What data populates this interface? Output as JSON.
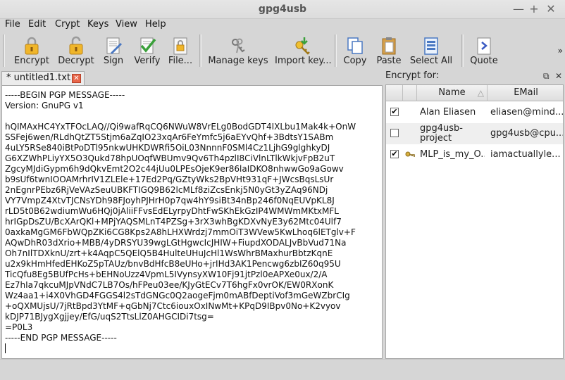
{
  "window": {
    "title": "gpg4usb"
  },
  "menu": [
    "File",
    "Edit",
    "Crypt",
    "Keys",
    "View",
    "Help"
  ],
  "toolbar": {
    "encrypt": "Encrypt",
    "decrypt": "Decrypt",
    "sign": "Sign",
    "verify": "Verify",
    "file": "File...",
    "manage_keys": "Manage keys",
    "import_key": "Import key...",
    "copy": "Copy",
    "paste": "Paste",
    "select_all": "Select All",
    "quote": "Quote",
    "more": "»"
  },
  "tab": {
    "label": "* untitled1.txt"
  },
  "editor": {
    "lines": [
      "-----BEGIN PGP MESSAGE-----",
      "Version: GnuPG v1",
      "",
      "hQIMAxHC4YxTFOcLAQ//Qi9wafRqCQ6NWuW8VrELg0BodGDT4IXLbu1Mak4k+OnW",
      "SSFej6wen/RLdhQtZT5Stjm6aZqIO23xqAr6FeYmfc5j6aEYvQhf+3BdtsY1SABm",
      "4uLY5RSe840iBtPoDTl95nkwUHKDWRfi5OiL03NnnnF0SMl4Cz1LjhG9glghkyDJ",
      "G6XZWhPLiyYX5O3Qukd78hpUOqfWBUmv9Qv6Th4pzlI8CiVlnLTlkWkjvFpB2uT",
      "ZgcyMJdiGypm6h9dQkvEmt2O2c44jUu0LPEsOjeK9er86laIDKO8nhwwGo9aGowv",
      "b9sUf6twnIOOAMrhrIV1ZLEle+17Ed2Pq/GZtyWks2BpVHt931qF+JWcsBqsLsUr",
      "2nEgnrPEbz6RjVeVAzSeuUBKFTIGQ9B62lcMLf8ziZcsEnkj5N0yGt3yZAq96NDj",
      "VY7VmpZ4XtvTJCNsYDh98FJoyhPJHrH0p7qw4hY9siBt34nBp246f0NqEUVpKL8J",
      "rLD5t0B62wdiumWu6HQj0jAliiFFvsEdELyrpyDhtFwSKhEkGzIP4WMWmMKtxMFL",
      "hrIGpDsZU/BcXArQKl+MPjYAQSMLnT4PZSg+3rX3whBgKDXvNyE3y62Mtc04Ulf7",
      "0axkaMgGM6FbWQpZKi6CG8Kps2A8hLHXWrdzj7mmOiT3WVew5KwLhoq6lETglv+F",
      "AQwDhR03dXrio+MBB/4yDRSYU39wgLGtHgwcIcJHIW+FiupdXODALJvBbVud71Na",
      "Oh7nIlTDXknU/zrt+k4AqpC5QElQ5B4HulteUHuJcHl1WsWhrBMaxhurBbtzKqnE",
      "u2x9kHmHfedEHKoZ5pTAUz/bnvBdHfcB8eUHo+jrIHd3AK1Pencwg6zbIZ60q95U",
      "TicQfu8Eg5BUfPcHs+bEHNoUzz4VpmL5IVynsyXW10Fj91jtPzl0eAPXe0ux/2/A",
      "Ez7hIa7qkcuMJpVNdC7LB7Os/hFPeu03ee/KJyGtECv7T6hgFx0vrOK/EW0RXonK",
      "Wz4aa1+i4X0VhGD4FGGS4l2sTdGNGc0Q2aogeFjm0mABfDeptiVof3mGeWZbrCIg",
      "+oQXMUjsU/7jRtBpd3YtMF+qGbNj7Ctc6iouxOxINwMt+KPqD9IBpv0No+K2vyov",
      "kDJP71BJygXgjjey/EfG/uqS2TtsLlZ0AHGCIDi7tsg=",
      "=P0L3",
      "-----END PGP MESSAGE-----",
      ""
    ]
  },
  "dock": {
    "title": "Encrypt for:",
    "float_icon": "⧉",
    "close_icon": "✕",
    "columns": {
      "name": "Name",
      "email": "EMail"
    },
    "sort_indicator": "△",
    "keys": [
      {
        "checked": true,
        "has_secret": false,
        "name": "Alan Eliasen",
        "email": "eliasen@mind..."
      },
      {
        "checked": false,
        "has_secret": false,
        "name": "gpg4usb-project",
        "email": "gpg4usb@cpu..."
      },
      {
        "checked": true,
        "has_secret": true,
        "name": "MLP_is_my_O...",
        "email": "iamactuallyle..."
      }
    ]
  },
  "window_controls": {
    "minimize": "—",
    "maximize": "+",
    "close": "✕"
  },
  "colors": {
    "accent": "#2e77c8",
    "tab_close": "#e8664a"
  }
}
